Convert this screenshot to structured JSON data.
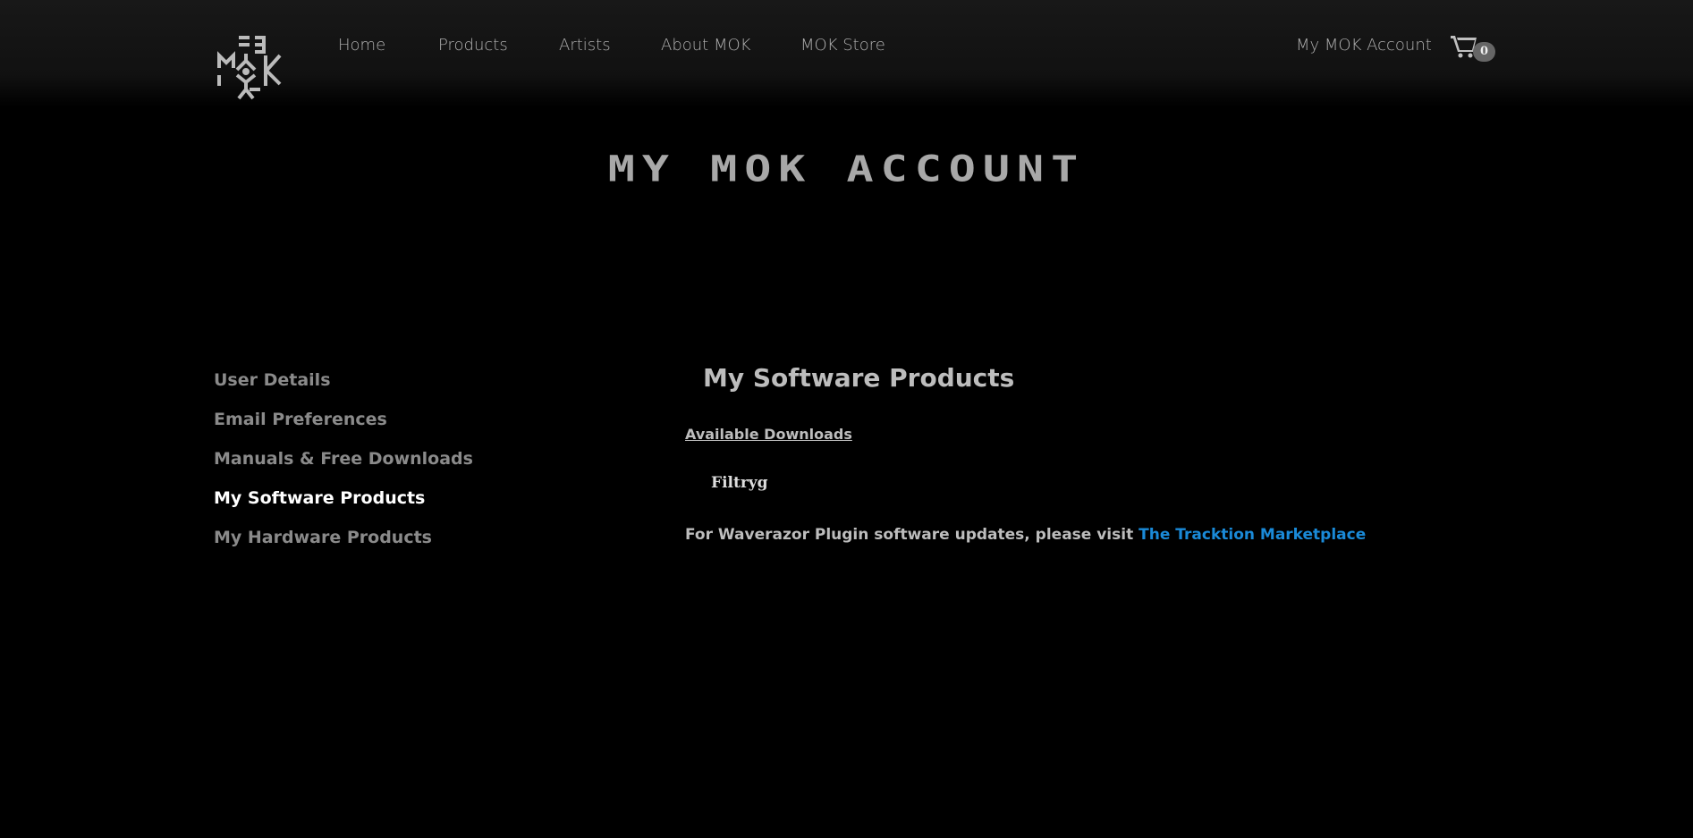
{
  "nav": {
    "items": [
      "Home",
      "Products",
      "Artists",
      "About MOK",
      "MOK Store"
    ],
    "account": "My MOK Account",
    "cart_count": "0"
  },
  "page_title": "My MOK Account",
  "sidebar": {
    "items": [
      {
        "label": "User Details"
      },
      {
        "label": "Email Preferences"
      },
      {
        "label": "Manuals & Free Downloads"
      },
      {
        "label": "My Software Products",
        "active": true
      },
      {
        "label": "My Hardware Products"
      }
    ]
  },
  "main": {
    "heading": "My Software Products",
    "downloads_link": "Available Downloads",
    "product": "Filtryg",
    "note": "For Waverazor Plugin software updates, please visit ",
    "note_link": "The Tracktion Marketplace"
  },
  "colors": {
    "link": "#1a8ad8",
    "background": "#000000"
  }
}
